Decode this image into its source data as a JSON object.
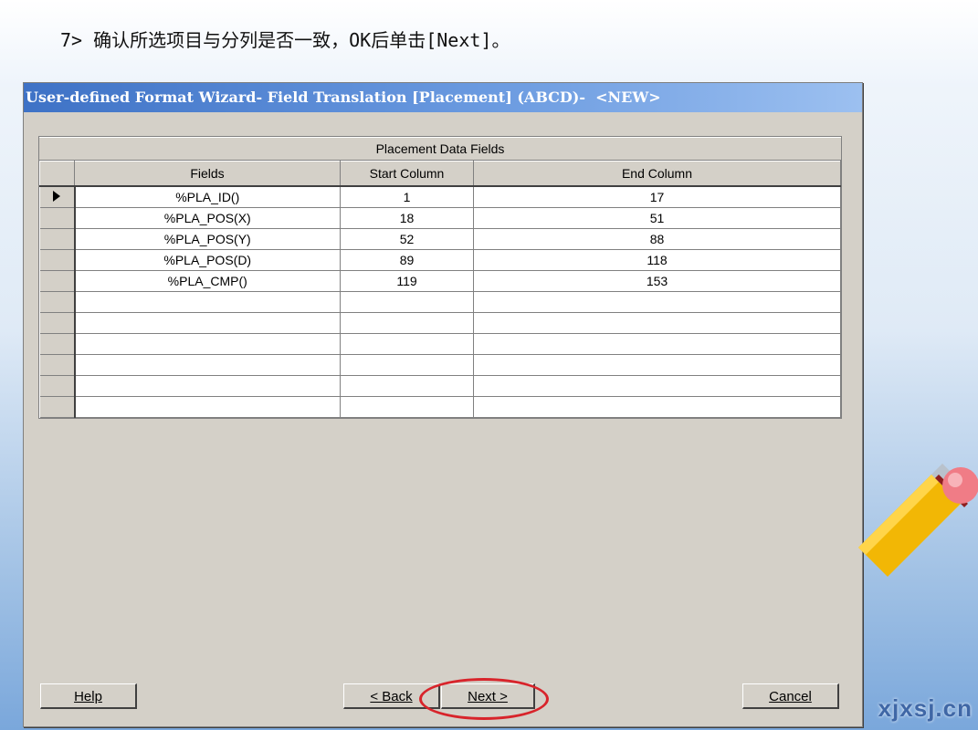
{
  "instruction": "7> 确认所选项目与分列是否一致，OK后单击[Next]。",
  "brand": "xjxsj.cn",
  "dialog": {
    "title": "User-defined Format Wizard- Field Translation [Placement] (ABCD)-  <NEW>",
    "grid": {
      "caption": "Placement Data Fields",
      "headers": {
        "fields": "Fields",
        "start": "Start Column",
        "end": "End Column"
      },
      "rows": [
        {
          "field": "%PLA_ID()",
          "start": "1",
          "end": "17"
        },
        {
          "field": "%PLA_POS(X)",
          "start": "18",
          "end": "51"
        },
        {
          "field": "%PLA_POS(Y)",
          "start": "52",
          "end": "88"
        },
        {
          "field": "%PLA_POS(D)",
          "start": "89",
          "end": "118"
        },
        {
          "field": "%PLA_CMP()",
          "start": "119",
          "end": "153"
        }
      ]
    },
    "buttons": {
      "help": "Help",
      "back": "< Back",
      "next": "Next >",
      "cancel": "Cancel"
    },
    "highlight_color": "#d8242b",
    "title_gradient": [
      "#3e72c6",
      "#9cc0f0"
    ]
  }
}
